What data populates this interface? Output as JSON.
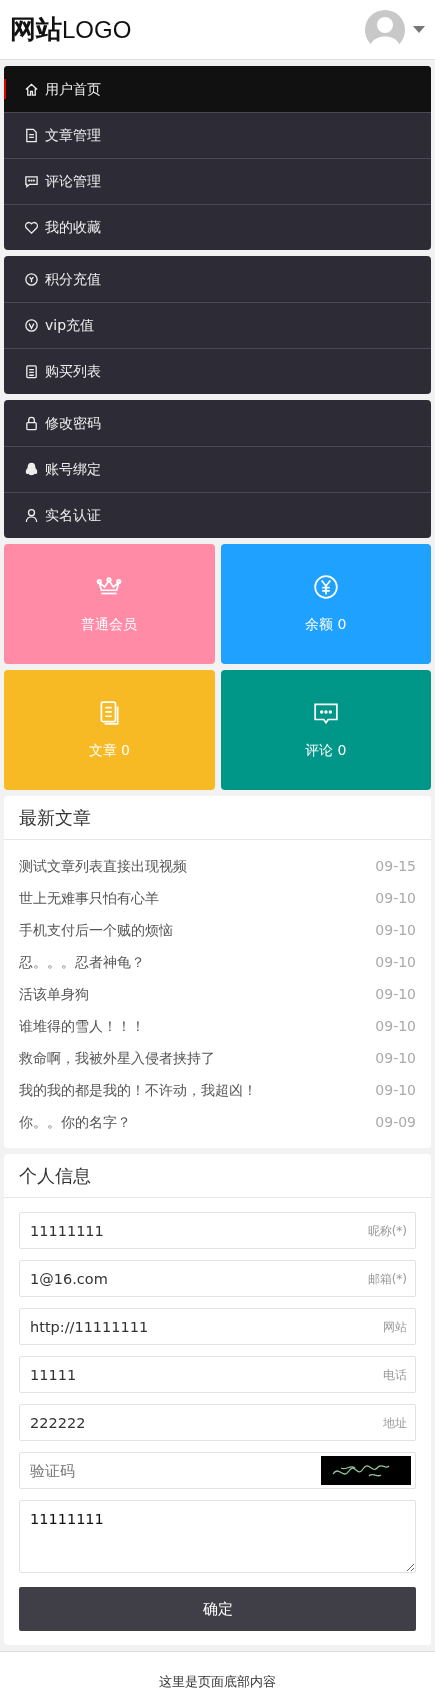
{
  "header": {
    "logo_bold": "网站",
    "logo_light": "LOGO"
  },
  "menu_groups": [
    {
      "items": [
        {
          "label": "用户首页",
          "selected": true
        },
        {
          "label": "文章管理",
          "selected": false
        },
        {
          "label": "评论管理",
          "selected": false
        },
        {
          "label": "我的收藏",
          "selected": false
        }
      ]
    },
    {
      "items": [
        {
          "label": "积分充值",
          "selected": false
        },
        {
          "label": "vip充值",
          "selected": false
        },
        {
          "label": "购买列表",
          "selected": false
        }
      ]
    },
    {
      "items": [
        {
          "label": "修改密码",
          "selected": false
        },
        {
          "label": "账号绑定",
          "selected": false
        },
        {
          "label": "实名认证",
          "selected": false
        }
      ]
    }
  ],
  "tiles": [
    {
      "label": "普通会员",
      "color": "#ff8ba7"
    },
    {
      "label": "余额 0",
      "color": "#1fa2ff"
    },
    {
      "label": "文章 0",
      "color": "#f7b924"
    },
    {
      "label": "评论 0",
      "color": "#009688"
    }
  ],
  "articles": {
    "title": "最新文章",
    "items": [
      {
        "title": "测试文章列表直接出现视频",
        "date": "09-15"
      },
      {
        "title": "世上无难事只怕有心羊",
        "date": "09-10"
      },
      {
        "title": "手机支付后一个贼的烦恼",
        "date": "09-10"
      },
      {
        "title": "忍。。。忍者神龟？",
        "date": "09-10"
      },
      {
        "title": "活该单身狗",
        "date": "09-10"
      },
      {
        "title": "谁堆得的雪人！！！",
        "date": "09-10"
      },
      {
        "title": "救命啊，我被外星入侵者挟持了",
        "date": "09-10"
      },
      {
        "title": "我的我的都是我的！不许动，我超凶！",
        "date": "09-10"
      },
      {
        "title": "你。。你的名字？",
        "date": "09-09"
      }
    ]
  },
  "profile": {
    "title": "个人信息",
    "fields": [
      {
        "value": "11111111",
        "hint": "昵称(*)"
      },
      {
        "value": "1@16.com",
        "hint": "邮箱(*)"
      },
      {
        "value": "http://11111111",
        "hint": "网站"
      },
      {
        "value": "11111",
        "hint": "电话"
      },
      {
        "value": "222222",
        "hint": "地址"
      }
    ],
    "captcha": {
      "placeholder": "验证码"
    },
    "message": "11111111",
    "submit": "确定"
  },
  "footer": "这里是页面底部内容"
}
